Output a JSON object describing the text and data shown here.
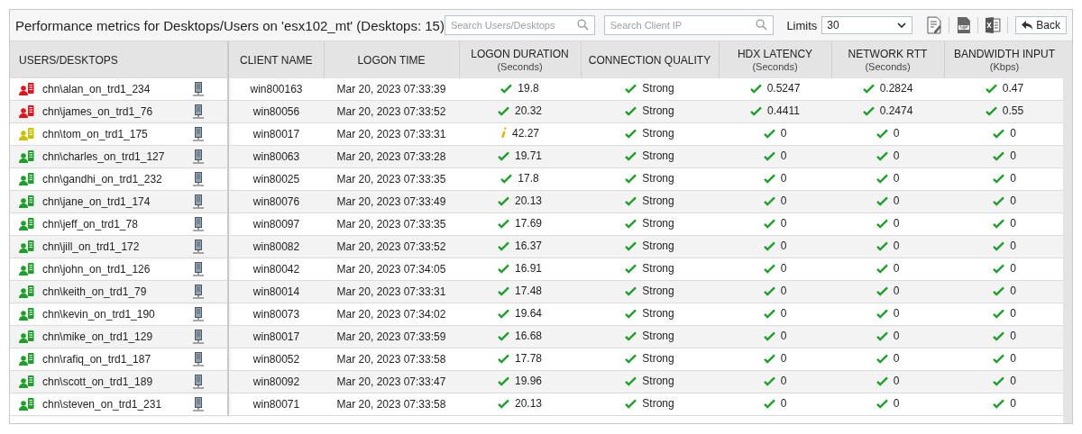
{
  "title": "Performance metrics for Desktops/Users on 'esx102_mt' (Desktops: 15)",
  "search_users": {
    "placeholder": "Search Users/Desktops"
  },
  "search_ip": {
    "placeholder": "Search Client IP"
  },
  "limits": {
    "label": "Limits",
    "value": "30"
  },
  "back_button": "Back",
  "columns": [
    {
      "label": "USERS/DESKTOPS"
    },
    {
      "label": "CLIENT NAME"
    },
    {
      "label": "LOGON TIME"
    },
    {
      "label": "LOGON DURATION",
      "unit": "(Seconds)"
    },
    {
      "label": "CONNECTION QUALITY"
    },
    {
      "label": "HDX LATENCY",
      "unit": "(Seconds)"
    },
    {
      "label": "NETWORK RTT",
      "unit": "(Seconds)"
    },
    {
      "label": "BANDWIDTH INPUT",
      "unit": "(Kbps)"
    }
  ],
  "rows": [
    {
      "user": "chn\\alan_on_trd1_234",
      "color": "#e0141e",
      "client": "win800163",
      "time": "Mar 20, 2023 07:33:39",
      "metrics": [
        {
          "value": "19.8",
          "kind": "ok"
        },
        {
          "value": "Strong",
          "kind": "ok"
        },
        {
          "value": "0.5247",
          "kind": "ok"
        },
        {
          "value": "0.2824",
          "kind": "ok"
        },
        {
          "value": "0.47",
          "kind": "ok"
        }
      ]
    },
    {
      "user": "chn\\james_on_trd1_76",
      "color": "#e0141e",
      "client": "win80056",
      "time": "Mar 20, 2023 07:33:52",
      "metrics": [
        {
          "value": "20.32",
          "kind": "ok"
        },
        {
          "value": "Strong",
          "kind": "ok"
        },
        {
          "value": "0.4411",
          "kind": "ok"
        },
        {
          "value": "0.2474",
          "kind": "ok"
        },
        {
          "value": "0.55",
          "kind": "ok"
        }
      ]
    },
    {
      "user": "chn\\tom_on_trd1_175",
      "color": "#c8c000",
      "client": "win80017",
      "time": "Mar 20, 2023 07:33:31",
      "metrics": [
        {
          "value": "42.27",
          "kind": "info"
        },
        {
          "value": "Strong",
          "kind": "ok"
        },
        {
          "value": "0",
          "kind": "ok"
        },
        {
          "value": "0",
          "kind": "ok"
        },
        {
          "value": "0",
          "kind": "ok"
        }
      ]
    },
    {
      "user": "chn\\charles_on_trd1_127",
      "color": "#1f9e2c",
      "client": "win80063",
      "time": "Mar 20, 2023 07:33:28",
      "metrics": [
        {
          "value": "19.71",
          "kind": "ok"
        },
        {
          "value": "Strong",
          "kind": "ok"
        },
        {
          "value": "0",
          "kind": "ok"
        },
        {
          "value": "0",
          "kind": "ok"
        },
        {
          "value": "0",
          "kind": "ok"
        }
      ]
    },
    {
      "user": "chn\\gandhi_on_trd1_232",
      "color": "#1f9e2c",
      "client": "win80025",
      "time": "Mar 20, 2023 07:33:35",
      "metrics": [
        {
          "value": "17.8",
          "kind": "ok"
        },
        {
          "value": "Strong",
          "kind": "ok"
        },
        {
          "value": "0",
          "kind": "ok"
        },
        {
          "value": "0",
          "kind": "ok"
        },
        {
          "value": "0",
          "kind": "ok"
        }
      ]
    },
    {
      "user": "chn\\jane_on_trd1_174",
      "color": "#1f9e2c",
      "client": "win80076",
      "time": "Mar 20, 2023 07:33:49",
      "metrics": [
        {
          "value": "20.13",
          "kind": "ok"
        },
        {
          "value": "Strong",
          "kind": "ok"
        },
        {
          "value": "0",
          "kind": "ok"
        },
        {
          "value": "0",
          "kind": "ok"
        },
        {
          "value": "0",
          "kind": "ok"
        }
      ]
    },
    {
      "user": "chn\\jeff_on_trd1_78",
      "color": "#1f9e2c",
      "client": "win80097",
      "time": "Mar 20, 2023 07:33:35",
      "metrics": [
        {
          "value": "17.69",
          "kind": "ok"
        },
        {
          "value": "Strong",
          "kind": "ok"
        },
        {
          "value": "0",
          "kind": "ok"
        },
        {
          "value": "0",
          "kind": "ok"
        },
        {
          "value": "0",
          "kind": "ok"
        }
      ]
    },
    {
      "user": "chn\\jill_on_trd1_172",
      "color": "#1f9e2c",
      "client": "win80082",
      "time": "Mar 20, 2023 07:33:52",
      "metrics": [
        {
          "value": "16.37",
          "kind": "ok"
        },
        {
          "value": "Strong",
          "kind": "ok"
        },
        {
          "value": "0",
          "kind": "ok"
        },
        {
          "value": "0",
          "kind": "ok"
        },
        {
          "value": "0",
          "kind": "ok"
        }
      ]
    },
    {
      "user": "chn\\john_on_trd1_126",
      "color": "#1f9e2c",
      "client": "win80042",
      "time": "Mar 20, 2023 07:34:05",
      "metrics": [
        {
          "value": "16.91",
          "kind": "ok"
        },
        {
          "value": "Strong",
          "kind": "ok"
        },
        {
          "value": "0",
          "kind": "ok"
        },
        {
          "value": "0",
          "kind": "ok"
        },
        {
          "value": "0",
          "kind": "ok"
        }
      ]
    },
    {
      "user": "chn\\keith_on_trd1_79",
      "color": "#1f9e2c",
      "client": "win80014",
      "time": "Mar 20, 2023 07:33:31",
      "metrics": [
        {
          "value": "17.48",
          "kind": "ok"
        },
        {
          "value": "Strong",
          "kind": "ok"
        },
        {
          "value": "0",
          "kind": "ok"
        },
        {
          "value": "0",
          "kind": "ok"
        },
        {
          "value": "0",
          "kind": "ok"
        }
      ]
    },
    {
      "user": "chn\\kevin_on_trd1_190",
      "color": "#1f9e2c",
      "client": "win80073",
      "time": "Mar 20, 2023 07:34:02",
      "metrics": [
        {
          "value": "19.64",
          "kind": "ok"
        },
        {
          "value": "Strong",
          "kind": "ok"
        },
        {
          "value": "0",
          "kind": "ok"
        },
        {
          "value": "0",
          "kind": "ok"
        },
        {
          "value": "0",
          "kind": "ok"
        }
      ]
    },
    {
      "user": "chn\\mike_on_trd1_129",
      "color": "#1f9e2c",
      "client": "win80017",
      "time": "Mar 20, 2023 07:33:59",
      "metrics": [
        {
          "value": "16.68",
          "kind": "ok"
        },
        {
          "value": "Strong",
          "kind": "ok"
        },
        {
          "value": "0",
          "kind": "ok"
        },
        {
          "value": "0",
          "kind": "ok"
        },
        {
          "value": "0",
          "kind": "ok"
        }
      ]
    },
    {
      "user": "chn\\rafiq_on_trd1_187",
      "color": "#1f9e2c",
      "client": "win80052",
      "time": "Mar 20, 2023 07:33:58",
      "metrics": [
        {
          "value": "17.78",
          "kind": "ok"
        },
        {
          "value": "Strong",
          "kind": "ok"
        },
        {
          "value": "0",
          "kind": "ok"
        },
        {
          "value": "0",
          "kind": "ok"
        },
        {
          "value": "0",
          "kind": "ok"
        }
      ]
    },
    {
      "user": "chn\\scott_on_trd1_189",
      "color": "#1f9e2c",
      "client": "win80092",
      "time": "Mar 20, 2023 07:33:47",
      "metrics": [
        {
          "value": "19.96",
          "kind": "ok"
        },
        {
          "value": "Strong",
          "kind": "ok"
        },
        {
          "value": "0",
          "kind": "ok"
        },
        {
          "value": "0",
          "kind": "ok"
        },
        {
          "value": "0",
          "kind": "ok"
        }
      ]
    },
    {
      "user": "chn\\steven_on_trd1_231",
      "color": "#1f9e2c",
      "client": "win80071",
      "time": "Mar 20, 2023 07:33:58",
      "metrics": [
        {
          "value": "20.13",
          "kind": "ok"
        },
        {
          "value": "Strong",
          "kind": "ok"
        },
        {
          "value": "0",
          "kind": "ok"
        },
        {
          "value": "0",
          "kind": "ok"
        },
        {
          "value": "0",
          "kind": "ok"
        }
      ]
    }
  ]
}
